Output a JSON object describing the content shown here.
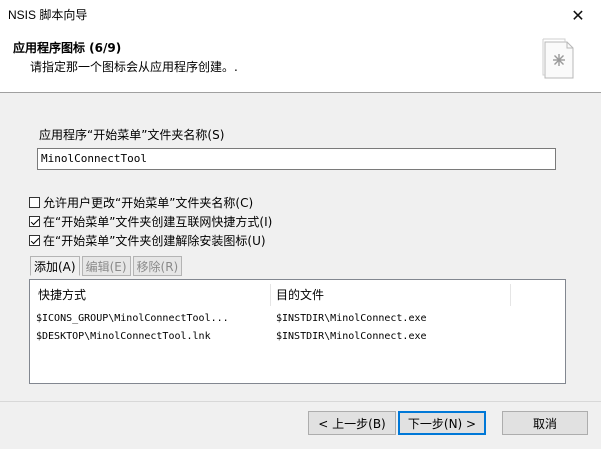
{
  "window": {
    "title": "NSIS 脚本向导",
    "close_glyph": "✕"
  },
  "header": {
    "title": "应用程序图标 (6/9)",
    "subtitle": "请指定那一个图标会从应用程序创建。.",
    "icon": "document-star-icon"
  },
  "form": {
    "folder_label": "应用程序“开始菜单”文件夹名称(S)",
    "folder_value": "MinolConnectTool",
    "checkboxes": [
      {
        "label": "允许用户更改“开始菜单”文件夹名称(C)",
        "checked": false
      },
      {
        "label": "在“开始菜单”文件夹创建互联网快捷方式(I)",
        "checked": true
      },
      {
        "label": "在“开始菜单”文件夹创建解除安装图标(U)",
        "checked": true
      }
    ]
  },
  "tabs": [
    {
      "label": "添加(A)",
      "enabled": true
    },
    {
      "label": "编辑(E)",
      "enabled": false
    },
    {
      "label": "移除(R)",
      "enabled": false
    }
  ],
  "list": {
    "columns": [
      "快捷方式",
      "目的文件"
    ],
    "rows": [
      [
        "$ICONS_GROUP\\MinolConnectTool...",
        "$INSTDIR\\MinolConnect.exe"
      ],
      [
        "$DESKTOP\\MinolConnectTool.lnk",
        "$INSTDIR\\MinolConnect.exe"
      ]
    ]
  },
  "buttons": {
    "back": "< 上一步(B)",
    "next": "下一步(N) >",
    "cancel": "取消"
  },
  "colors": {
    "accent": "#0078d7",
    "background": "#f0f0f0"
  }
}
